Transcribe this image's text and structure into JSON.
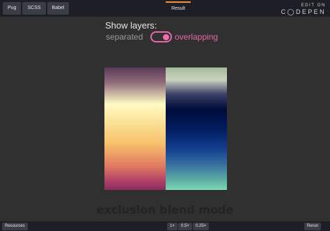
{
  "editor_tabs": [
    "Pug",
    "SCSS",
    "Babel"
  ],
  "result_tab": "Result",
  "codepen": {
    "line1": "EDIT ON",
    "line2": "C◯DEPEN"
  },
  "demo": {
    "heading": "Show layers:",
    "option_left": "separated",
    "option_right": "overlapping",
    "toggle_state": "overlapping",
    "caption": "exclusion blend mode"
  },
  "colors": {
    "accent_pink": "#e66aa8",
    "tab_highlight": "#f58f3b"
  },
  "bottom": {
    "resources": "Resources",
    "zoom": [
      "1×",
      "0.5×",
      "0.25×"
    ],
    "rerun": "Rerun"
  }
}
